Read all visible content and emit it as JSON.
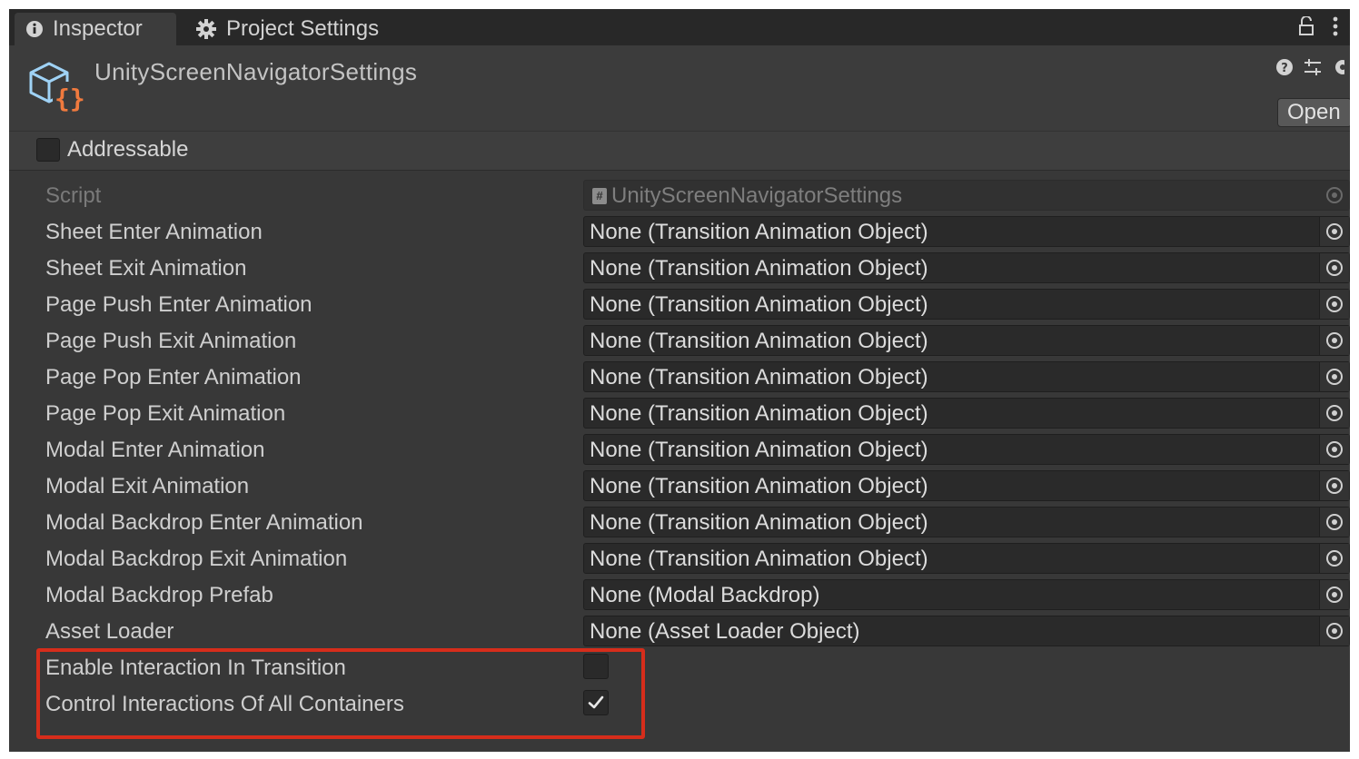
{
  "tabs": [
    {
      "label": "Inspector",
      "icon": "info-icon",
      "active": true
    },
    {
      "label": "Project Settings",
      "icon": "gear-icon",
      "active": false
    }
  ],
  "header": {
    "title": "UnityScreenNavigatorSettings",
    "icon": "scriptable-object-icon",
    "open_label": "Open"
  },
  "addressable": {
    "label": "Addressable",
    "checked": false
  },
  "properties": [
    {
      "label": "Script",
      "value": "UnityScreenNavigatorSettings",
      "disabled": true
    },
    {
      "label": "Sheet Enter Animation",
      "value": "None (Transition Animation Object)"
    },
    {
      "label": "Sheet Exit Animation",
      "value": "None (Transition Animation Object)"
    },
    {
      "label": "Page Push Enter Animation",
      "value": "None (Transition Animation Object)"
    },
    {
      "label": "Page Push Exit Animation",
      "value": "None (Transition Animation Object)"
    },
    {
      "label": "Page Pop Enter Animation",
      "value": "None (Transition Animation Object)"
    },
    {
      "label": "Page Pop Exit Animation",
      "value": "None (Transition Animation Object)"
    },
    {
      "label": "Modal Enter Animation",
      "value": "None (Transition Animation Object)"
    },
    {
      "label": "Modal Exit Animation",
      "value": "None (Transition Animation Object)"
    },
    {
      "label": "Modal Backdrop Enter Animation",
      "value": "None (Transition Animation Object)"
    },
    {
      "label": "Modal Backdrop Exit Animation",
      "value": "None (Transition Animation Object)"
    },
    {
      "label": "Modal Backdrop Prefab",
      "value": "None (Modal Backdrop)"
    },
    {
      "label": "Asset Loader",
      "value": "None (Asset Loader Object)"
    }
  ],
  "toggles": [
    {
      "label": "Enable Interaction In Transition",
      "checked": false
    },
    {
      "label": "Control Interactions Of All Containers",
      "checked": true
    }
  ],
  "colors": {
    "highlight": "#d62d1b",
    "panel": "#383838",
    "field": "#2a2a2a"
  }
}
